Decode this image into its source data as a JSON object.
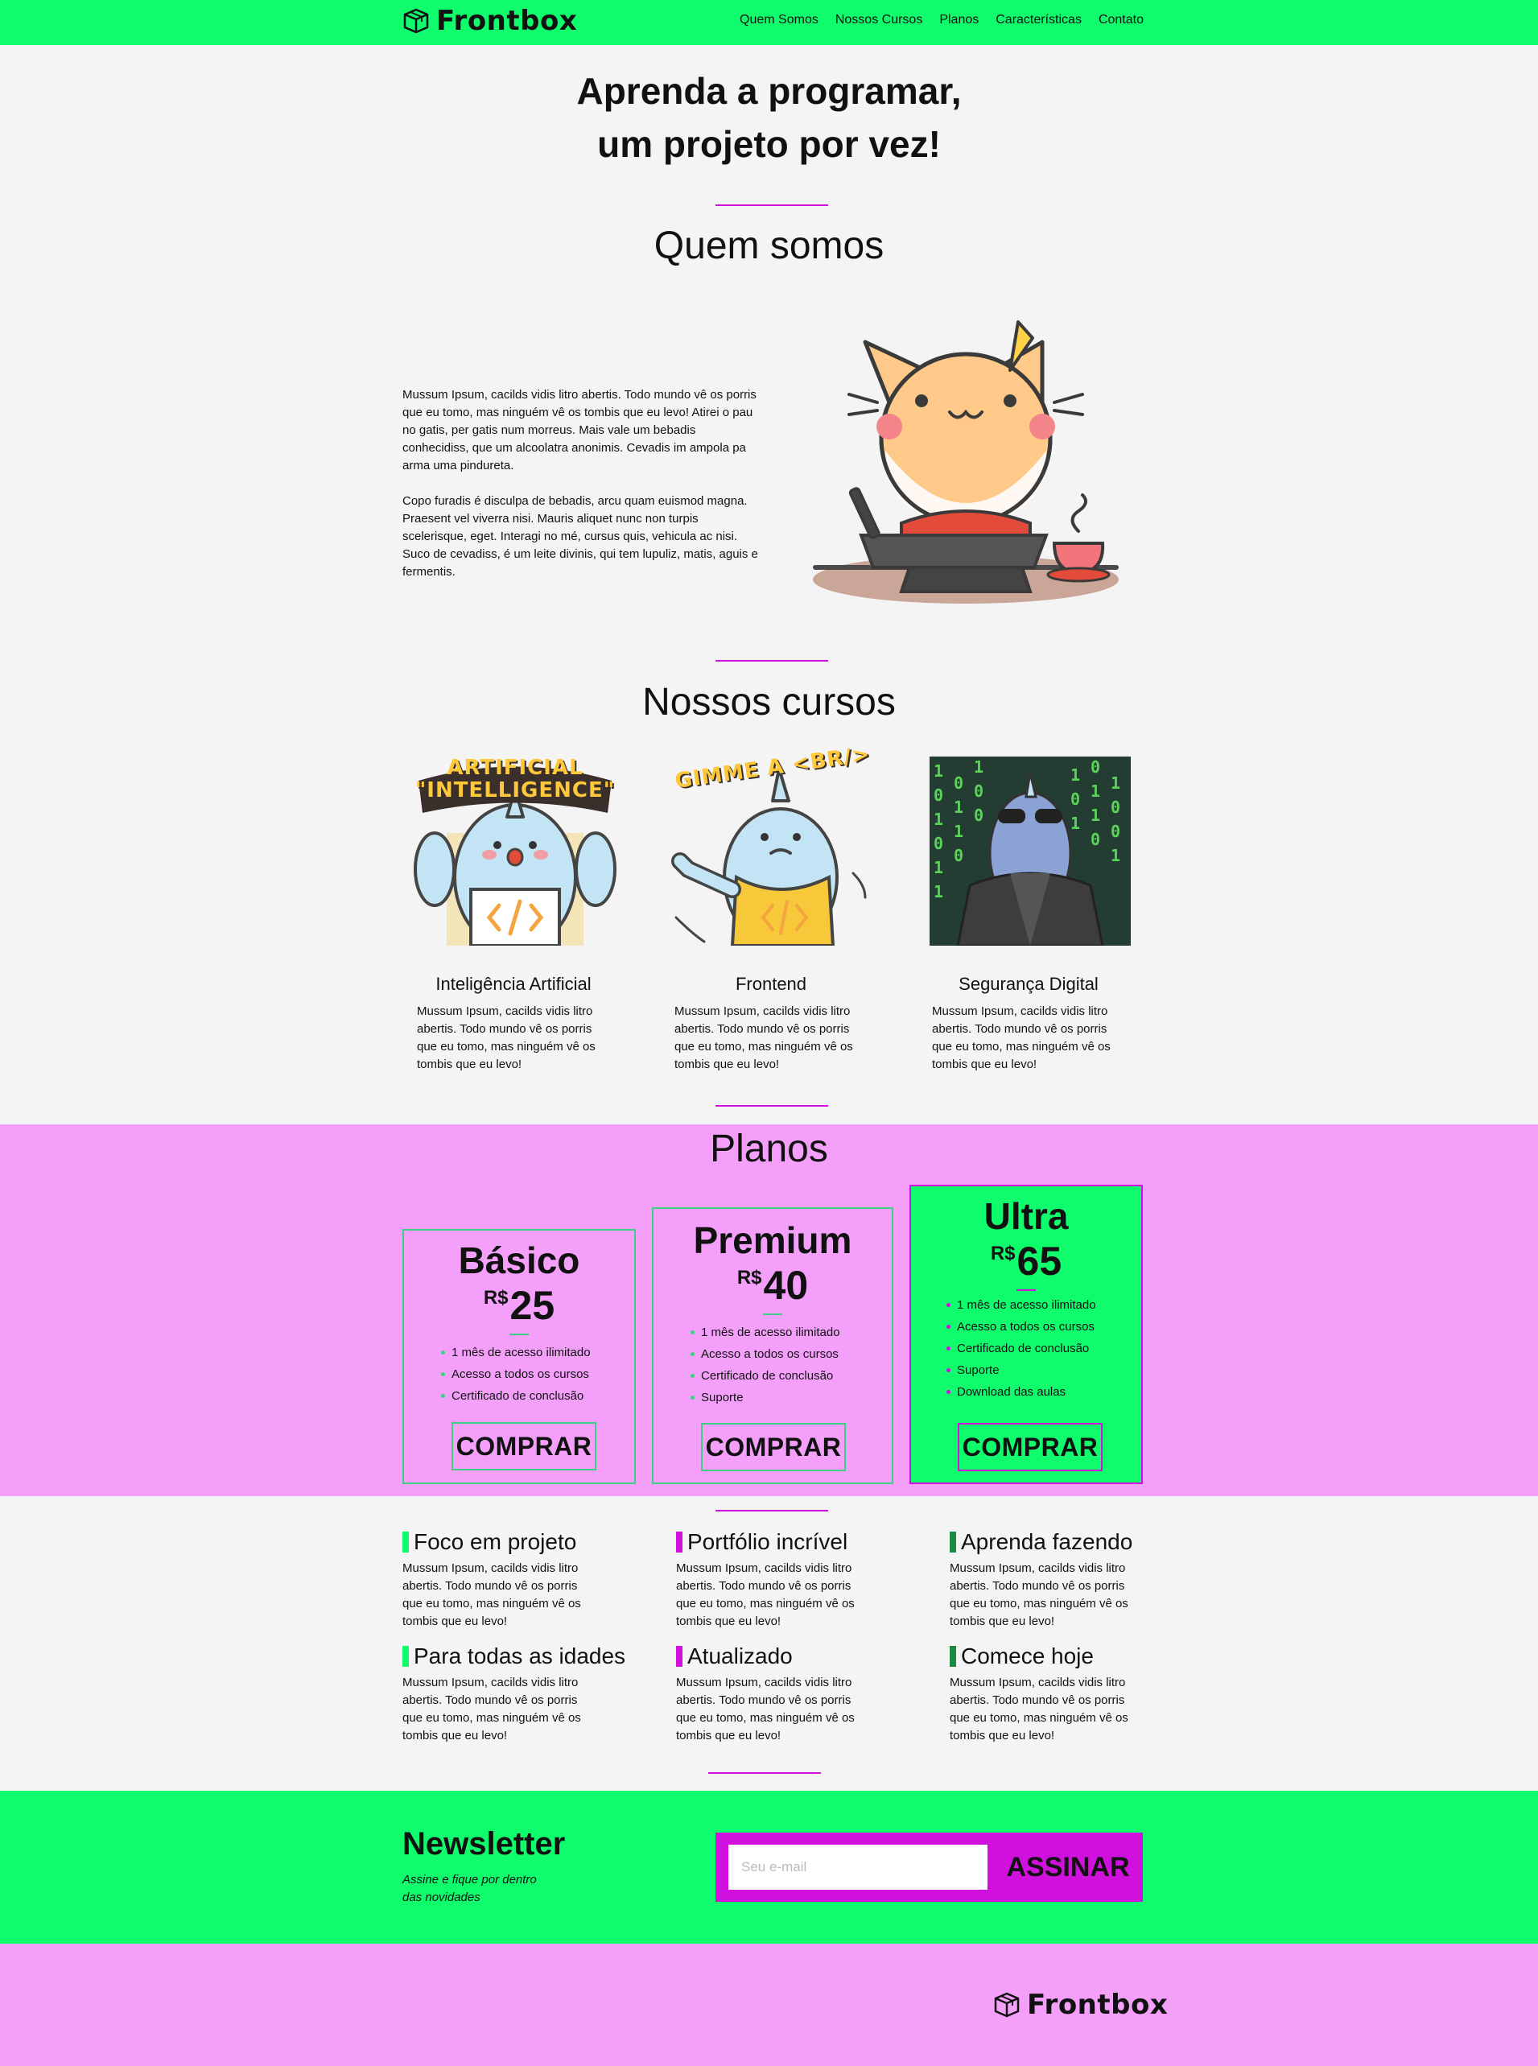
{
  "brand": {
    "name": "Frontbox"
  },
  "nav": {
    "items": [
      "Quem Somos",
      "Nossos Cursos",
      "Planos",
      "Características",
      "Contato"
    ]
  },
  "hero": {
    "line1": "Aprenda a programar,",
    "line2": "um projeto por vez!"
  },
  "about": {
    "title": "Quem somos",
    "p1": "Mussum Ipsum, cacilds vidis litro abertis. Todo mundo vê os porris que eu tomo, mas ninguém vê os tombis que eu levo! Atirei o pau no gatis, per gatis num morreus. Mais vale um bebadis conhecidiss, que um alcoolatra anonimis. Cevadis im ampola pa arma uma pindureta.",
    "p2": "Copo furadis é disculpa de bebadis, arcu quam euismod magna. Praesent vel viverra nisi. Mauris aliquet nunc non turpis scelerisque, eget. Interagi no mé, cursus quis, vehicula ac nisi. Suco de cevadiss, é um leite divinis, qui tem lupuliz, matis, aguis e fermentis."
  },
  "courses": {
    "title": "Nossos cursos",
    "items": [
      {
        "banner": "ARTIFICIAL \"INTELLIGENCE\"",
        "title": "Inteligência Artificial",
        "desc": "Mussum Ipsum, cacilds vidis litro abertis. Todo mundo vê os porris que eu tomo, mas ninguém vê os tombis que eu levo!"
      },
      {
        "banner": "GIMME A <BR/>",
        "title": "Frontend",
        "desc": "Mussum Ipsum, cacilds vidis litro abertis. Todo mundo vê os porris que eu tomo, mas ninguém vê os tombis que eu levo!"
      },
      {
        "banner": "",
        "title": "Segurança Digital",
        "desc": "Mussum Ipsum, cacilds vidis litro abertis. Todo mundo vê os porris que eu tomo, mas ninguém vê os tombis que eu levo!"
      }
    ]
  },
  "plans": {
    "title": "Planos",
    "items": [
      {
        "name": "Básico",
        "currency": "R$",
        "price": "25",
        "features": [
          "1 mês de acesso ilimitado",
          "Acesso a todos os cursos",
          "Certificado de conclusão"
        ],
        "button": "COMPRAR"
      },
      {
        "name": "Premium",
        "currency": "R$",
        "price": "40",
        "features": [
          "1 mês de acesso ilimitado",
          "Acesso a todos os cursos",
          "Certificado de conclusão",
          "Suporte"
        ],
        "button": "COMPRAR"
      },
      {
        "name": "Ultra",
        "currency": "R$",
        "price": "65",
        "features": [
          "1 mês de acesso ilimitado",
          "Acesso a todos os cursos",
          "Certificado de conclusão",
          "Suporte",
          "Download das aulas"
        ],
        "button": "COMPRAR"
      }
    ]
  },
  "features": {
    "items": [
      {
        "title": "Foco em projeto",
        "color": "#0ffc6c",
        "desc": "Mussum Ipsum, cacilds vidis litro abertis. Todo mundo vê os porris que eu tomo, mas ninguém vê os tombis que eu levo!"
      },
      {
        "title": "Portfólio incrível",
        "color": "#d010dd",
        "desc": "Mussum Ipsum, cacilds vidis litro abertis. Todo mundo vê os porris que eu tomo, mas ninguém vê os tombis que eu levo!"
      },
      {
        "title": "Aprenda fazendo",
        "color": "#188a43",
        "desc": "Mussum Ipsum, cacilds vidis litro abertis. Todo mundo vê os porris que eu tomo, mas ninguém vê os tombis que eu levo!"
      },
      {
        "title": "Para todas as idades",
        "color": "#0ffc6c",
        "desc": "Mussum Ipsum, cacilds vidis litro abertis. Todo mundo vê os porris que eu tomo, mas ninguém vê os tombis que eu levo!"
      },
      {
        "title": "Atualizado",
        "color": "#d010dd",
        "desc": "Mussum Ipsum, cacilds vidis litro abertis. Todo mundo vê os porris que eu tomo, mas ninguém vê os tombis que eu levo!"
      },
      {
        "title": "Comece hoje",
        "color": "#188a43",
        "desc": "Mussum Ipsum, cacilds vidis litro abertis. Todo mundo vê os porris que eu tomo, mas ninguém vê os tombis que eu levo!"
      }
    ]
  },
  "newsletter": {
    "title": "Newsletter",
    "subtitle_line1": "Assine e fique por dentro",
    "subtitle_line2": "das novidades",
    "placeholder": "Seu e-mail",
    "button": "ASSINAR"
  },
  "colors": {
    "green": "#0ffc6c",
    "pink": "#f4a0fb",
    "magenta": "#d010dd",
    "dark_green": "#188a43",
    "plan_border": "#3bd081"
  }
}
